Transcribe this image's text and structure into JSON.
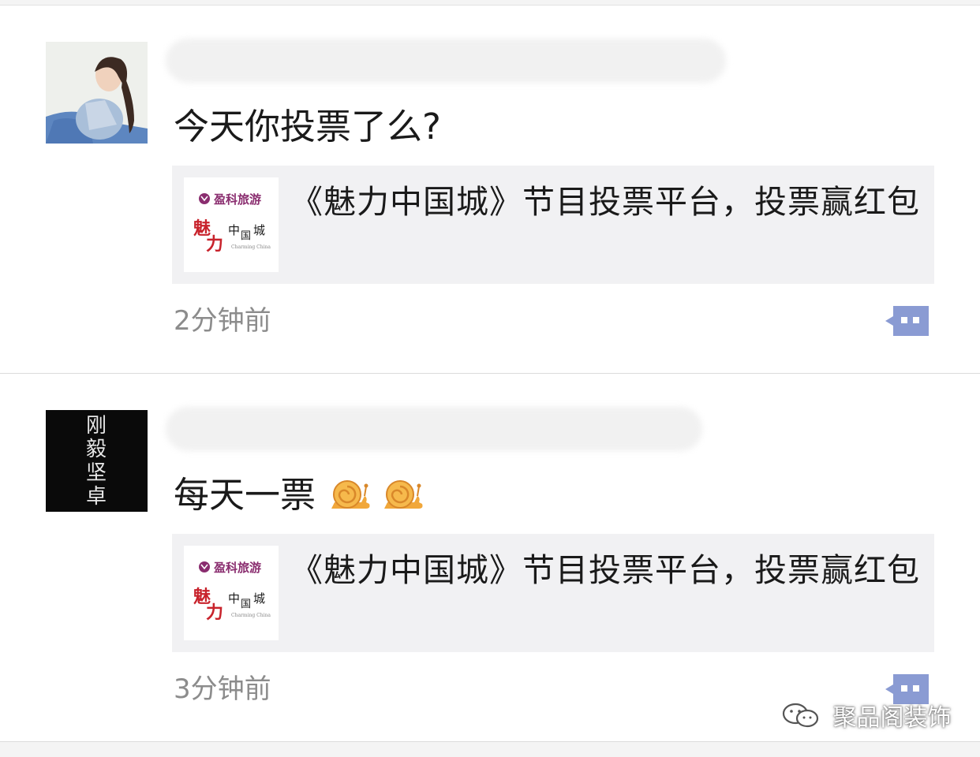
{
  "posts": [
    {
      "text": "今天你投票了么?",
      "card": {
        "title": "《魅力中国城》节目投票平台，投票赢红包",
        "brand": "盈科旅游",
        "logo_text": "魅力中国城",
        "logo_sub": "Charming China"
      },
      "time": "2分钟前"
    },
    {
      "text": "每天一票",
      "avatar_text": "刚毅坚卓",
      "card": {
        "title": "《魅力中国城》节目投票平台，投票赢红包",
        "brand": "盈科旅游",
        "logo_text": "魅力中国城",
        "logo_sub": "Charming China"
      },
      "time": "3分钟前"
    }
  ],
  "watermark": {
    "text": "聚品阁装饰"
  },
  "colors": {
    "card_bg": "#f1f1f3",
    "comment_icon": "#8a9bd3",
    "time": "#8c8c8c"
  }
}
